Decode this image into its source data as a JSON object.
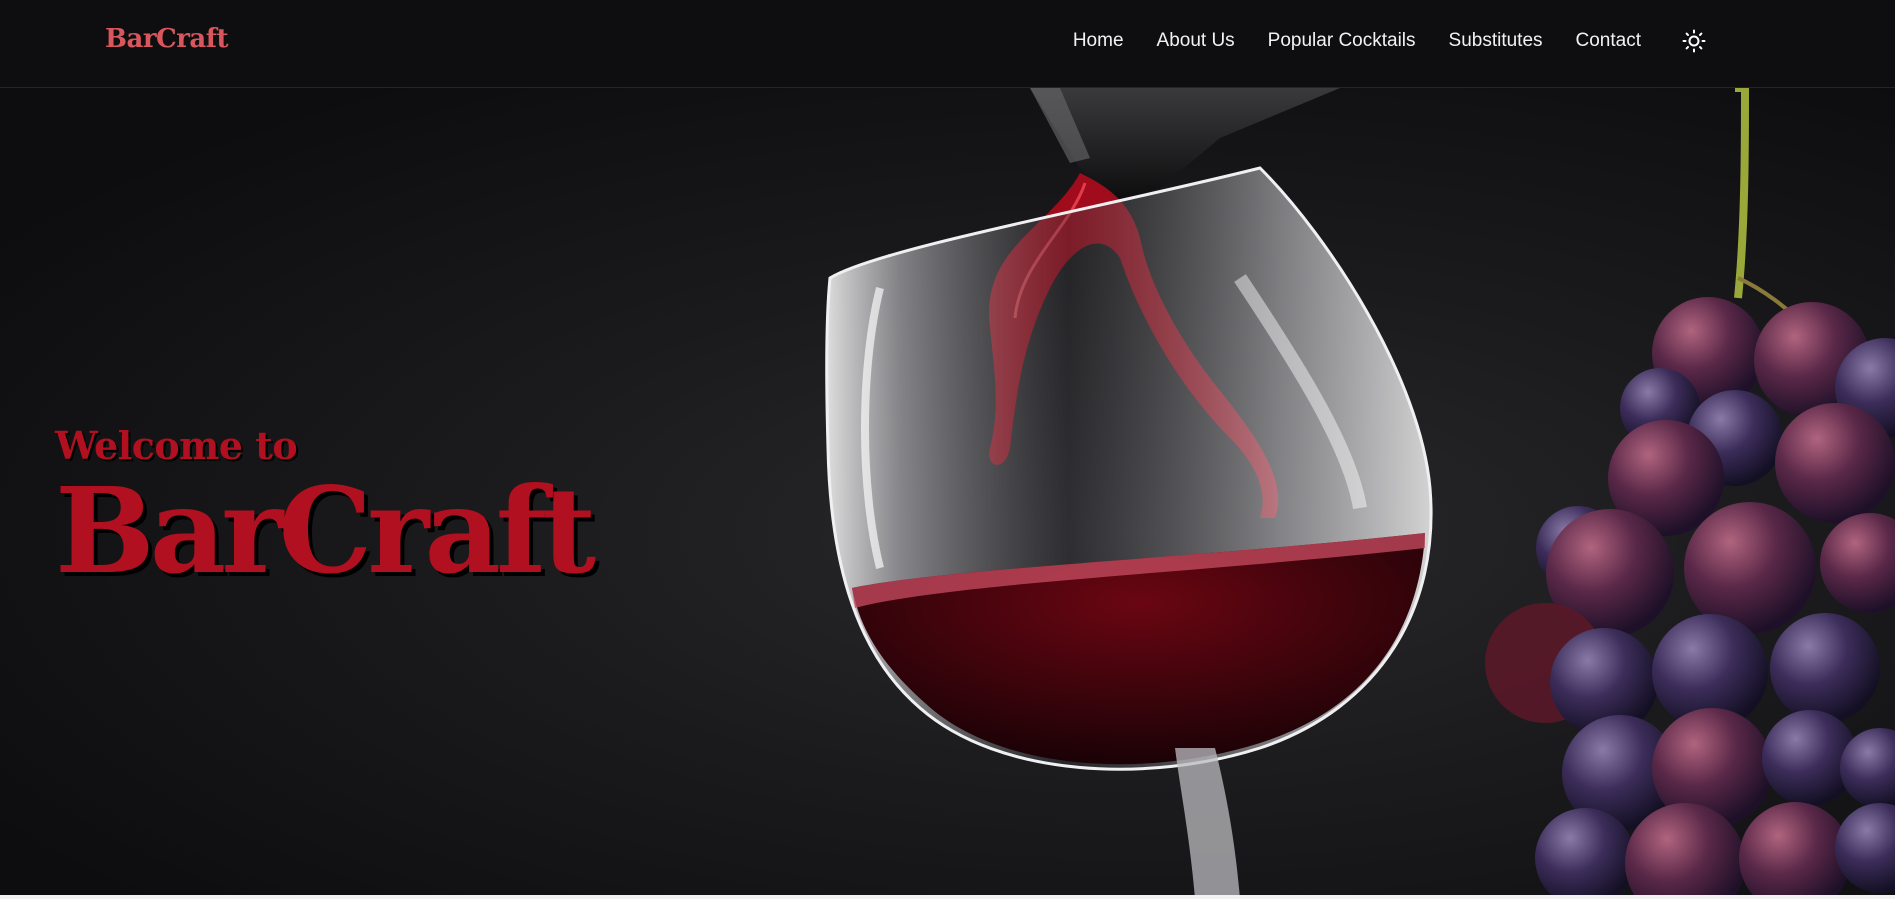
{
  "brand": {
    "logo_text": "BarCraft",
    "logo_color": "#d9575c"
  },
  "nav": {
    "items": [
      {
        "label": "Home"
      },
      {
        "label": "About Us"
      },
      {
        "label": "Popular Cocktails"
      },
      {
        "label": "Substitutes"
      },
      {
        "label": "Contact"
      }
    ],
    "theme_icon": "sun-icon"
  },
  "hero": {
    "welcome": "Welcome to",
    "title": "BarCraft",
    "accent_color": "#b0101f",
    "image_subject": "red-wine-pour-with-grapes"
  }
}
